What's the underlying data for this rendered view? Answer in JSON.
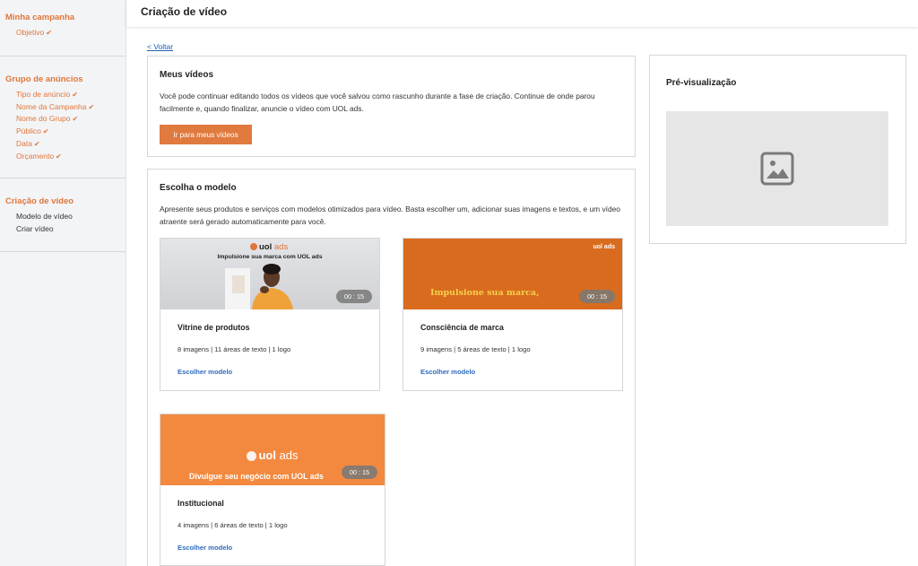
{
  "sidebar": {
    "sections": [
      {
        "title": "Minha campanha",
        "items": [
          {
            "label": "Objetivo",
            "done": true
          }
        ]
      },
      {
        "title": "Grupo de anúncios",
        "items": [
          {
            "label": "Tipo de anúncio",
            "done": true
          },
          {
            "label": "Nome da Campanha",
            "done": true
          },
          {
            "label": "Nome do Grupo",
            "done": true
          },
          {
            "label": "Público",
            "done": true
          },
          {
            "label": "Data",
            "done": true
          },
          {
            "label": "Orçamento",
            "done": true
          }
        ]
      },
      {
        "title": "Criação de vídeo",
        "items": [
          {
            "label": "Modelo de vídeo",
            "done": false
          },
          {
            "label": "Criar vídeo",
            "done": false
          }
        ]
      }
    ],
    "check_glyph": "✔"
  },
  "header": {
    "title": "Criação de vídeo"
  },
  "back_link": "< Voltar",
  "my_videos": {
    "title": "Meus vídeos",
    "description": "Você pode continuar editando todos os vídeos que você salvou como rascunho durante a fase de criação. Continue de onde parou facilmente e, quando finalizar, anuncie o vídeo com UOL ads.",
    "button_label": "Ir para meus vídeos"
  },
  "models": {
    "title": "Escolha o modelo",
    "description": "Apresente seus produtos e serviços com modelos otimizados para vídeo. Basta escolher um, adicionar suas imagens e textos, e um vídeo atraente será gerado automaticamente para você.",
    "cards": [
      {
        "name": "Vitrine de produtos",
        "meta": "8 imagens | 11 áreas de texto | 1 logo",
        "link": "Escolher modelo",
        "duration": "00 : 15",
        "thumb_logo": "uol",
        "thumb_logo_ads": "ads",
        "thumb_headline": "Impulsione sua marca com UOL ads"
      },
      {
        "name": "Consciência de marca",
        "meta": "9 imagens | 5 áreas de texto | 1 logo",
        "link": "Escolher modelo",
        "duration": "00 : 15",
        "thumb_logo": "uol ads",
        "thumb_headline": "Impulsione sua marca,"
      },
      {
        "name": "Institucional",
        "meta": "4 imagens | 6 áreas de texto | 1 logo",
        "link": "Escolher modelo",
        "duration": "00 : 15",
        "thumb_logo": "uol",
        "thumb_logo_ads": "ads",
        "thumb_headline": "Divulgue seu negócio com UOL ads"
      }
    ]
  },
  "preview": {
    "title": "Pré-visualização",
    "icon": "image-placeholder-icon"
  },
  "colors": {
    "accent": "#e0763a",
    "link": "#2d6bbd",
    "card2_bg": "#d96b1f",
    "card3_bg": "#f2893f"
  }
}
